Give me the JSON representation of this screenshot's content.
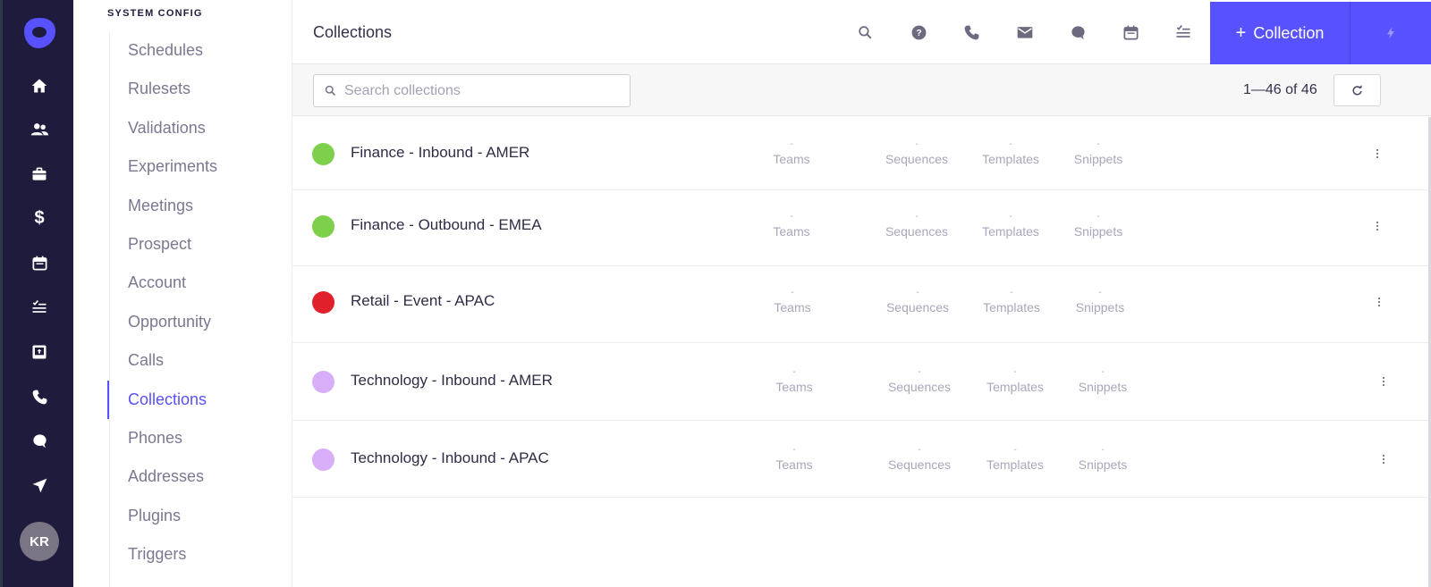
{
  "rail": {
    "logo": "outreach-logo-icon",
    "icons": [
      "home-icon",
      "people-icon",
      "briefcase-icon",
      "dollar-icon",
      "calendar-icon",
      "tasks-icon",
      "inbox-upload-icon",
      "phone-icon",
      "chat-icon",
      "send-icon"
    ],
    "avatar_initials": "KR"
  },
  "nav": {
    "section_title": "SYSTEM CONFIG",
    "items": [
      {
        "label": "Schedules",
        "active": false
      },
      {
        "label": "Rulesets",
        "active": false
      },
      {
        "label": "Validations",
        "active": false
      },
      {
        "label": "Experiments",
        "active": false
      },
      {
        "label": "Meetings",
        "active": false
      },
      {
        "label": "Prospect",
        "active": false
      },
      {
        "label": "Account",
        "active": false
      },
      {
        "label": "Opportunity",
        "active": false
      },
      {
        "label": "Calls",
        "active": false
      },
      {
        "label": "Collections",
        "active": true
      },
      {
        "label": "Phones",
        "active": false
      },
      {
        "label": "Addresses",
        "active": false
      },
      {
        "label": "Plugins",
        "active": false
      },
      {
        "label": "Triggers",
        "active": false
      }
    ]
  },
  "header": {
    "title": "Collections",
    "icons": [
      "search-icon",
      "help-icon",
      "phone-icon",
      "mail-icon",
      "chat-icon",
      "calendar-icon",
      "tasks-icon"
    ],
    "primary_button": {
      "plus": "+",
      "label": "Collection"
    },
    "bolt_button": "bolt-icon"
  },
  "toolbar": {
    "search_placeholder": "Search collections",
    "search_value": "",
    "count": "1—46 of 46"
  },
  "colors": {
    "accent": "#5851ff",
    "rail_bg": "#1f1b3d"
  },
  "collections": [
    {
      "name": "Finance - Inbound - AMER",
      "color": "#7ed04b",
      "teams": "-",
      "sequences": "-",
      "templates": "-",
      "snippets": "-"
    },
    {
      "name": "Finance - Outbound - EMEA",
      "color": "#7ed04b",
      "teams": "-",
      "sequences": "-",
      "templates": "-",
      "snippets": "-"
    },
    {
      "name": "Retail - Event - APAC",
      "color": "#e0212b",
      "teams": "-",
      "sequences": "-",
      "templates": "-",
      "snippets": "-"
    },
    {
      "name": "Technology - Inbound - AMER",
      "color": "#d9aef9",
      "teams": "-",
      "sequences": "-",
      "templates": "-",
      "snippets": "-"
    },
    {
      "name": "Technology - Inbound - APAC",
      "color": "#d9aef9",
      "teams": "-",
      "sequences": "-",
      "templates": "-",
      "snippets": "-"
    }
  ],
  "stat_labels": {
    "teams": "Teams",
    "sequences": "Sequences",
    "templates": "Templates",
    "snippets": "Snippets"
  }
}
